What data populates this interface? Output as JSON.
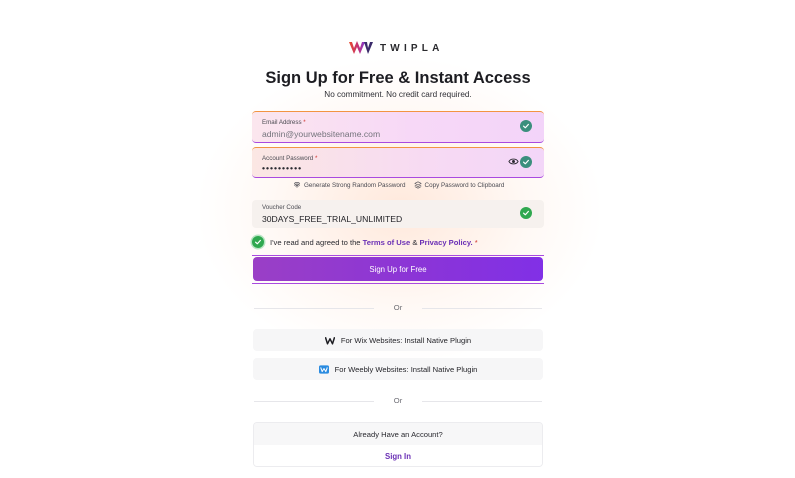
{
  "brand": {
    "name": "TWIPLA",
    "logo_icon": "twipla-logo-icon"
  },
  "header": {
    "title": "Sign Up for Free & Instant Access",
    "subtitle": "No commitment. No credit card required."
  },
  "form": {
    "email": {
      "label": "Email Address",
      "required_mark": "*",
      "placeholder": "admin@yourwebsitename.com",
      "status": "check-icon"
    },
    "password": {
      "label": "Account Password",
      "required_mark": "*",
      "value": "••••••••••",
      "status": "check-icon"
    },
    "helpers": {
      "generate": "Generate Strong Random Password",
      "copy": "Copy Password to Clipboard"
    },
    "voucher": {
      "label": "Voucher Code",
      "value": "30DAYS_FREE_TRIAL_UNLIMITED",
      "status": "check-icon"
    },
    "agreement": {
      "prefix": "I've read and agreed to the",
      "terms": "Terms of Use",
      "amp": "&",
      "privacy": "Privacy Policy.",
      "required_mark": "*"
    },
    "submit_label": "Sign Up for Free"
  },
  "divider_1": "Or",
  "plugins": {
    "wix": "For Wix Websites: Install Native Plugin",
    "weebly": "For Weebly Websites: Install Native Plugin"
  },
  "divider_2": "Or",
  "account": {
    "question": "Already Have an Account?",
    "sign_in": "Sign In"
  },
  "colors": {
    "accent_purple": "#8a34d8",
    "link_purple": "#6a2fb5",
    "check_green": "#2fa84f",
    "check_teal": "#3b8f7d"
  }
}
